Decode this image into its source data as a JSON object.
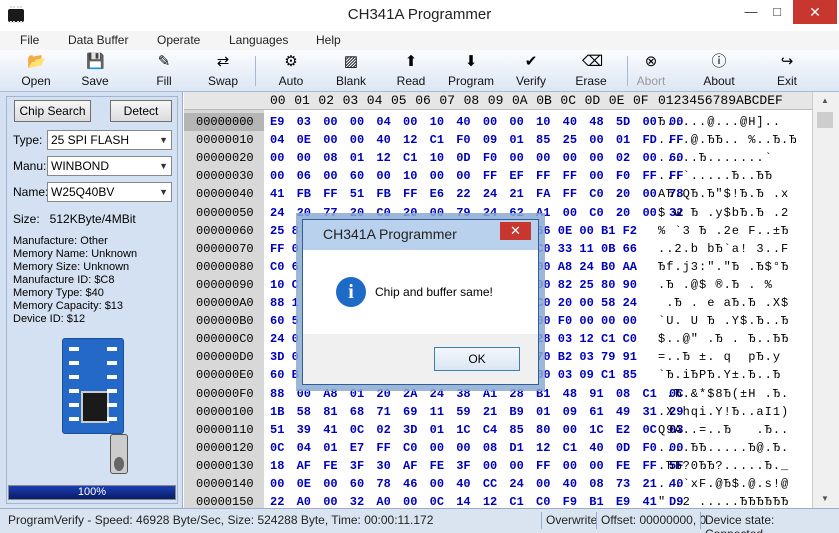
{
  "window": {
    "title": "CH341A Programmer",
    "min": "—",
    "max": "□",
    "close": "✕"
  },
  "menu": [
    "File",
    "Data Buffer",
    "Operate",
    "Languages",
    "Help"
  ],
  "toolbar": [
    {
      "label": "Open",
      "icon": "folder-icon",
      "glyph": "📂",
      "enabled": true
    },
    {
      "label": "Save",
      "icon": "save-icon",
      "glyph": "💾",
      "enabled": true
    },
    {
      "label": "Fill",
      "icon": "fill-icon",
      "glyph": "✎",
      "enabled": true
    },
    {
      "label": "Swap",
      "icon": "swap-icon",
      "glyph": "⇄",
      "enabled": true
    },
    {
      "label": "Auto",
      "icon": "auto-icon",
      "glyph": "⚙",
      "enabled": true
    },
    {
      "label": "Blank",
      "icon": "blank-icon",
      "glyph": "▨",
      "enabled": true
    },
    {
      "label": "Read",
      "icon": "read-icon",
      "glyph": "⬆",
      "enabled": true
    },
    {
      "label": "Program",
      "icon": "program-icon",
      "glyph": "⬇",
      "enabled": true
    },
    {
      "label": "Verify",
      "icon": "verify-icon",
      "glyph": "✔",
      "enabled": true
    },
    {
      "label": "Erase",
      "icon": "erase-icon",
      "glyph": "⌫",
      "enabled": true
    },
    {
      "label": "Abort",
      "icon": "abort-icon",
      "glyph": "⊗",
      "enabled": false
    },
    {
      "label": "About",
      "icon": "info-icon",
      "glyph": "ⓘ",
      "enabled": true
    },
    {
      "label": "Exit",
      "icon": "exit-icon",
      "glyph": "↪",
      "enabled": true
    }
  ],
  "left": {
    "chip_search": "Chip Search",
    "detect": "Detect",
    "type_label": "Type:",
    "type_value": "25 SPI FLASH",
    "manu_label": "Manu:",
    "manu_value": "WINBOND",
    "name_label": "Name:",
    "name_value": "W25Q40BV",
    "size": "Size:   512KByte/4MBit",
    "info": [
      "Manufacture: Other",
      "Memory Name: Unknown",
      "Memory Size: Unknown",
      "Manufacture ID: $C8",
      "Memory Type: $40",
      "Memory Capacity: $13",
      "Device ID: $12"
    ],
    "progress": "100%",
    "progress_value": 1.0
  },
  "hex": {
    "columns": [
      "00",
      "01",
      "02",
      "03",
      "04",
      "05",
      "06",
      "07",
      "08",
      "09",
      "0A",
      "0B",
      "0C",
      "0D",
      "0E",
      "0F"
    ],
    "ascii_header": "0123456789ABCDEF",
    "rows": [
      {
        "addr": "00000000",
        "bytes": "E9 03 00 00 04 00 10 40 00 00 10 40 48 5D 00 00",
        "ascii": "Ђ.....@...@H]..",
        "sel": true
      },
      {
        "addr": "00000010",
        "bytes": "04 0E 00 00 40 12 C1 F0 09 01 85 25 00 01 FD FF",
        "ascii": "....@.ЂЂ.. %..Ђ.Ђ"
      },
      {
        "addr": "00000020",
        "bytes": "00 00 08 01 12 C1 10 0D F0 00 00 00 00 02 00 60",
        "ascii": ".....Ђ.......`"
      },
      {
        "addr": "00000030",
        "bytes": "00 06 00 60 00 10 00 00 FF EF FF FF 00 F0 FF FF",
        "ascii": "...`.....Ђ..ЂЂ"
      },
      {
        "addr": "00000040",
        "bytes": "41 FB FF 51 FB FF E6 22 24 21 FA FF C0 20 00 78",
        "ascii": "AЂ.QЂ.Ђ\"$!Ђ.Ђ .x"
      },
      {
        "addr": "00000050",
        "bytes": "24 20 77 20 C0 20 00 79 24 62 A1 00 C0 20 00 32",
        "ascii": "$ w Ђ .y$bЂ.Ђ .2"
      },
      {
        "addr": "00000060",
        "bytes": "25 8 ",
        "ascii": "% `3 Ђ .2e F..±Ђ",
        "partial": "66 0E 00 B1 F2"
      },
      {
        "addr": "00000070",
        "bytes": "FF 0 ",
        "ascii": "..2.b bЂ`a! 3..F",
        "partial": "C0 33 11 0B 66"
      },
      {
        "addr": "00000080",
        "bytes": "C0 6 ",
        "ascii": "Ђf.j3:\".\"Ђ .Ђ$°Ђ",
        "partial": "00 A8 24 B0 AA"
      },
      {
        "addr": "00000090",
        "bytes": "10 C ",
        "ascii": ".Ђ .@$ ®.Ђ . %",
        "partial": "00 82 25 80 90"
      },
      {
        "addr": "000000A0",
        "bytes": "88 1 ",
        "ascii": " .Ђ . e aЂ.Ђ .X$",
        "partial": "C0 20 00 58 24"
      },
      {
        "addr": "000000B0",
        "bytes": "60 5 ",
        "ascii": "`U. U Ђ .Y$.Ђ..Ђ",
        "partial": "00 F0 00 00 00"
      },
      {
        "addr": "000000C0",
        "bytes": "24 0 ",
        "ascii": "$..@\" .Ђ . Ђ..ЂЂ",
        "partial": "28 03 12 C1 C0"
      },
      {
        "addr": "000000D0",
        "bytes": "3D 0 ",
        "ascii": "=..Ђ ±. q  pЂ.y",
        "partial": "70 B2 03 79 91"
      },
      {
        "addr": "000000E0",
        "bytes": "60 B ",
        "ascii": "`Ђ.iЂPЂ.Y±.Ђ..Ђ",
        "partial": "00 03 09 C1 85"
      },
      {
        "addr": "000000F0",
        "bytes": "88 00 A8 01 20 2A 24 38 A1 28 B1 48 91 08 C1 0C",
        "ascii": " .Ђ.&*$8Ђ(±H .Ђ."
      },
      {
        "addr": "00000100",
        "bytes": "1B 58 81 68 71 69 11 59 21 B9 01 09 61 49 31 29",
        "ascii": ".X hqi.Y!Ђ..aI1)"
      },
      {
        "addr": "00000110",
        "bytes": "51 39 41 0C 02 3D 01 1C C4 85 80 00 1C E2 0C 03",
        "ascii": "Q9A..=..Ђ   .Ђ.."
      },
      {
        "addr": "00000120",
        "bytes": "0C 04 01 E7 FF C0 00 00 08 D1 12 C1 40 0D F0 00",
        "ascii": "....ЂЂ.....Ђ@.Ђ."
      },
      {
        "addr": "00000130",
        "bytes": "18 AF FE 3F 30 AF FE 3F 00 00 FF 00 00 FE FF 5F",
        "ascii": ".ЂЂ?0ЂЂ?.....Ђ._"
      },
      {
        "addr": "00000140",
        "bytes": "00 0E 00 60 78 46 00 40 CC 24 00 40 08 73 21 40",
        "ascii": "...`xF.@Ђ$.@.s!@"
      },
      {
        "addr": "00000150",
        "bytes": "22 A0 00 32 A0 00 0C 14 12 C1 C0 F9 B1 E9 41 D9",
        "ascii": "\" .2 .....ЂЂЂЂЂЂ"
      }
    ]
  },
  "status": {
    "main": "ProgramVerify - Speed: 46928 Byte/Sec, Size: 524288 Byte, Time: 00:00:11.172",
    "mode": "Overwrite",
    "offset": "Offset: 00000000, 0",
    "device": "Device state: Connected."
  },
  "dialog": {
    "title": "CH341A Programmer",
    "message": "Chip and buffer same!",
    "ok": "OK",
    "close": "✕",
    "icon": "i"
  }
}
